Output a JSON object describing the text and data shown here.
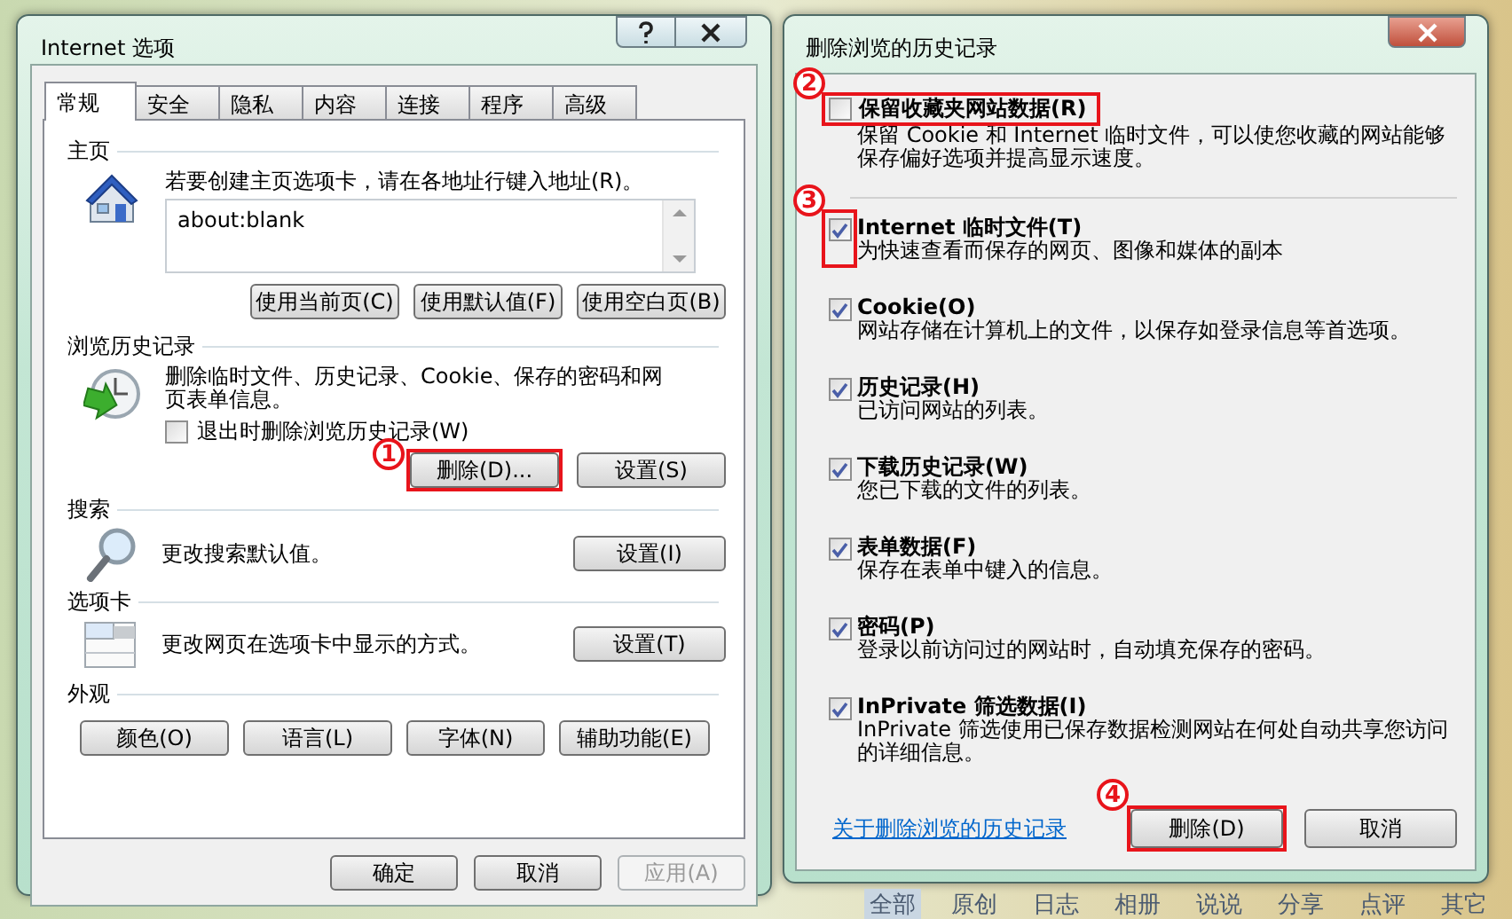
{
  "options_dialog": {
    "title": "Internet 选项",
    "tabs": [
      {
        "label": "常规",
        "selected": true
      },
      {
        "label": "安全",
        "selected": false
      },
      {
        "label": "隐私",
        "selected": false
      },
      {
        "label": "内容",
        "selected": false
      },
      {
        "label": "连接",
        "selected": false
      },
      {
        "label": "程序",
        "selected": false
      },
      {
        "label": "高级",
        "selected": false
      }
    ],
    "sections": [
      {
        "kind": "homepage",
        "heading": "主页",
        "description": "若要创建主页选项卡，请在各地址行键入地址(R)。",
        "address": "about:blank",
        "buttons": [
          {
            "label": "使用当前页(C)"
          },
          {
            "label": "使用默认值(F)"
          },
          {
            "label": "使用空白页(B)"
          }
        ]
      },
      {
        "kind": "history",
        "heading": "浏览历史记录",
        "description": "删除临时文件、历史记录、Cookie、保存的密码和网页表单信息。",
        "checkbox": {
          "label": "退出时删除浏览历史记录(W)",
          "checked": false
        },
        "buttons": [
          {
            "label": "删除(D)...",
            "highlight": "1"
          },
          {
            "label": "设置(S)"
          }
        ]
      },
      {
        "kind": "search",
        "heading": "搜索",
        "description": "更改搜索默认值。",
        "buttons": [
          {
            "label": "设置(I)"
          }
        ]
      },
      {
        "kind": "tabs",
        "heading": "选项卡",
        "description": "更改网页在选项卡中显示的方式。",
        "buttons": [
          {
            "label": "设置(T)"
          }
        ]
      },
      {
        "kind": "appearance",
        "heading": "外观",
        "buttons": [
          {
            "label": "颜色(O)"
          },
          {
            "label": "语言(L)"
          },
          {
            "label": "字体(N)"
          },
          {
            "label": "辅助功能(E)"
          }
        ]
      }
    ],
    "footer_buttons": [
      {
        "label": "确定",
        "disabled": false
      },
      {
        "label": "取消",
        "disabled": false
      },
      {
        "label": "应用(A)",
        "disabled": true
      }
    ]
  },
  "delete_dialog": {
    "title": "删除浏览的历史记录",
    "preserve_option": {
      "label": "保留收藏夹网站数据(R)",
      "description": "保留 Cookie 和 Internet 临时文件，可以使您收藏的网站能够保存偏好选项并提高显示速度。",
      "checked": false,
      "highlight": "2"
    },
    "options": [
      {
        "label": "Internet 临时文件(T)",
        "description": "为快速查看而保存的网页、图像和媒体的副本",
        "checked": true
      },
      {
        "label": "Cookie(O)",
        "description": "网站存储在计算机上的文件，以保存如登录信息等首选项。",
        "checked": true
      },
      {
        "label": "历史记录(H)",
        "description": "已访问网站的列表。",
        "checked": true
      },
      {
        "label": "下载历史记录(W)",
        "description": "您已下载的文件的列表。",
        "checked": true
      },
      {
        "label": "表单数据(F)",
        "description": "保存在表单中键入的信息。",
        "checked": true
      },
      {
        "label": "密码(P)",
        "description": "登录以前访问过的网站时，自动填充保存的密码。",
        "checked": true
      },
      {
        "label": "InPrivate 筛选数据(I)",
        "description": "InPrivate 筛选使用已保存数据检测网站在何处自动共享您访问的详细信息。",
        "checked": true
      }
    ],
    "options_highlight": "3",
    "link": "关于删除浏览的历史记录",
    "buttons": [
      {
        "label": "删除(D)",
        "highlight": "4"
      },
      {
        "label": "取消"
      }
    ]
  },
  "background_nav": [
    {
      "label": "全部",
      "selected": true
    },
    {
      "label": "原创",
      "selected": false
    },
    {
      "label": "日志",
      "selected": false
    },
    {
      "label": "相册",
      "selected": false
    },
    {
      "label": "说说",
      "selected": false
    },
    {
      "label": "分享",
      "selected": false
    },
    {
      "label": "点评",
      "selected": false
    },
    {
      "label": "其它",
      "selected": false
    }
  ]
}
